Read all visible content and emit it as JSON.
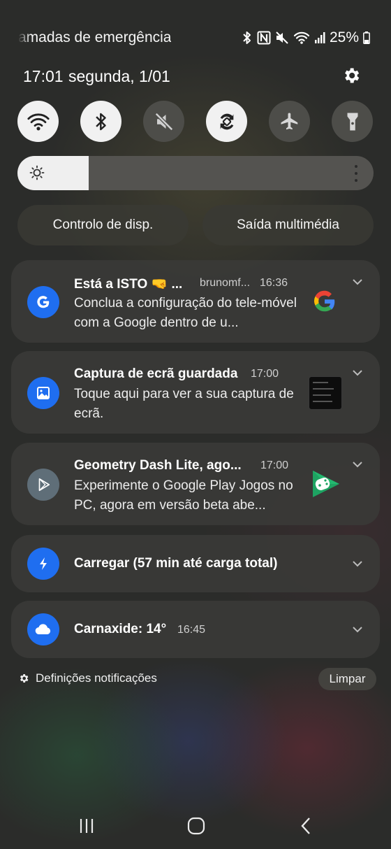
{
  "status_bar": {
    "carrier_text": "amadas de emergência",
    "battery_text": "25%",
    "icons": [
      "bluetooth-icon",
      "nfc-icon",
      "mute-icon",
      "wifi-icon",
      "signal-icon",
      "battery-icon"
    ]
  },
  "header": {
    "time": "17:01",
    "date": "segunda, 1/01",
    "settings_icon": "gear-icon"
  },
  "quick_toggles": [
    {
      "name": "wifi",
      "icon": "wifi-icon",
      "state": "on"
    },
    {
      "name": "bluetooth",
      "icon": "bluetooth-icon",
      "state": "on"
    },
    {
      "name": "sound",
      "icon": "mute-icon",
      "state": "off"
    },
    {
      "name": "auto-rotate",
      "icon": "rotate-icon",
      "state": "on"
    },
    {
      "name": "airplane",
      "icon": "airplane-icon",
      "state": "off"
    },
    {
      "name": "flashlight",
      "icon": "flashlight-icon",
      "state": "off"
    }
  ],
  "brightness": {
    "level": 0.2
  },
  "pill_buttons": {
    "device_control": "Controlo de disp.",
    "media_output": "Saída multimédia"
  },
  "notifications": [
    {
      "app": "Google",
      "icon": "google-g-icon",
      "title": "Está a ISTO 🤜 ...",
      "account": "brunomf...",
      "time": "16:36",
      "body": "Conclua a configuração do tele-móvel com a Google dentro de u..."
    },
    {
      "app": "Screenshot",
      "icon": "image-icon",
      "title": "Captura de ecrã guardada",
      "time": "17:00",
      "body": "Toque aqui para ver a sua captura de ecrã."
    },
    {
      "app": "Google Play Games",
      "icon": "play-games-icon",
      "title": "Geometry Dash Lite, ago...",
      "time": "17:00",
      "body": "Experimente o Google Play Jogos no PC, agora em versão beta abe..."
    },
    {
      "app": "Battery",
      "icon": "charging-bolt-icon",
      "title": "Carregar (57 min até carga total)"
    },
    {
      "app": "Weather",
      "icon": "cloud-icon",
      "title": "Carnaxide: 14°",
      "time": "16:45"
    }
  ],
  "footer": {
    "notification_settings": "Definições notificações",
    "clear": "Limpar"
  },
  "colors": {
    "accent_blue": "#1f6ef0",
    "toggle_on": "#f1f1f1",
    "toggle_off": "#4d4d49"
  }
}
